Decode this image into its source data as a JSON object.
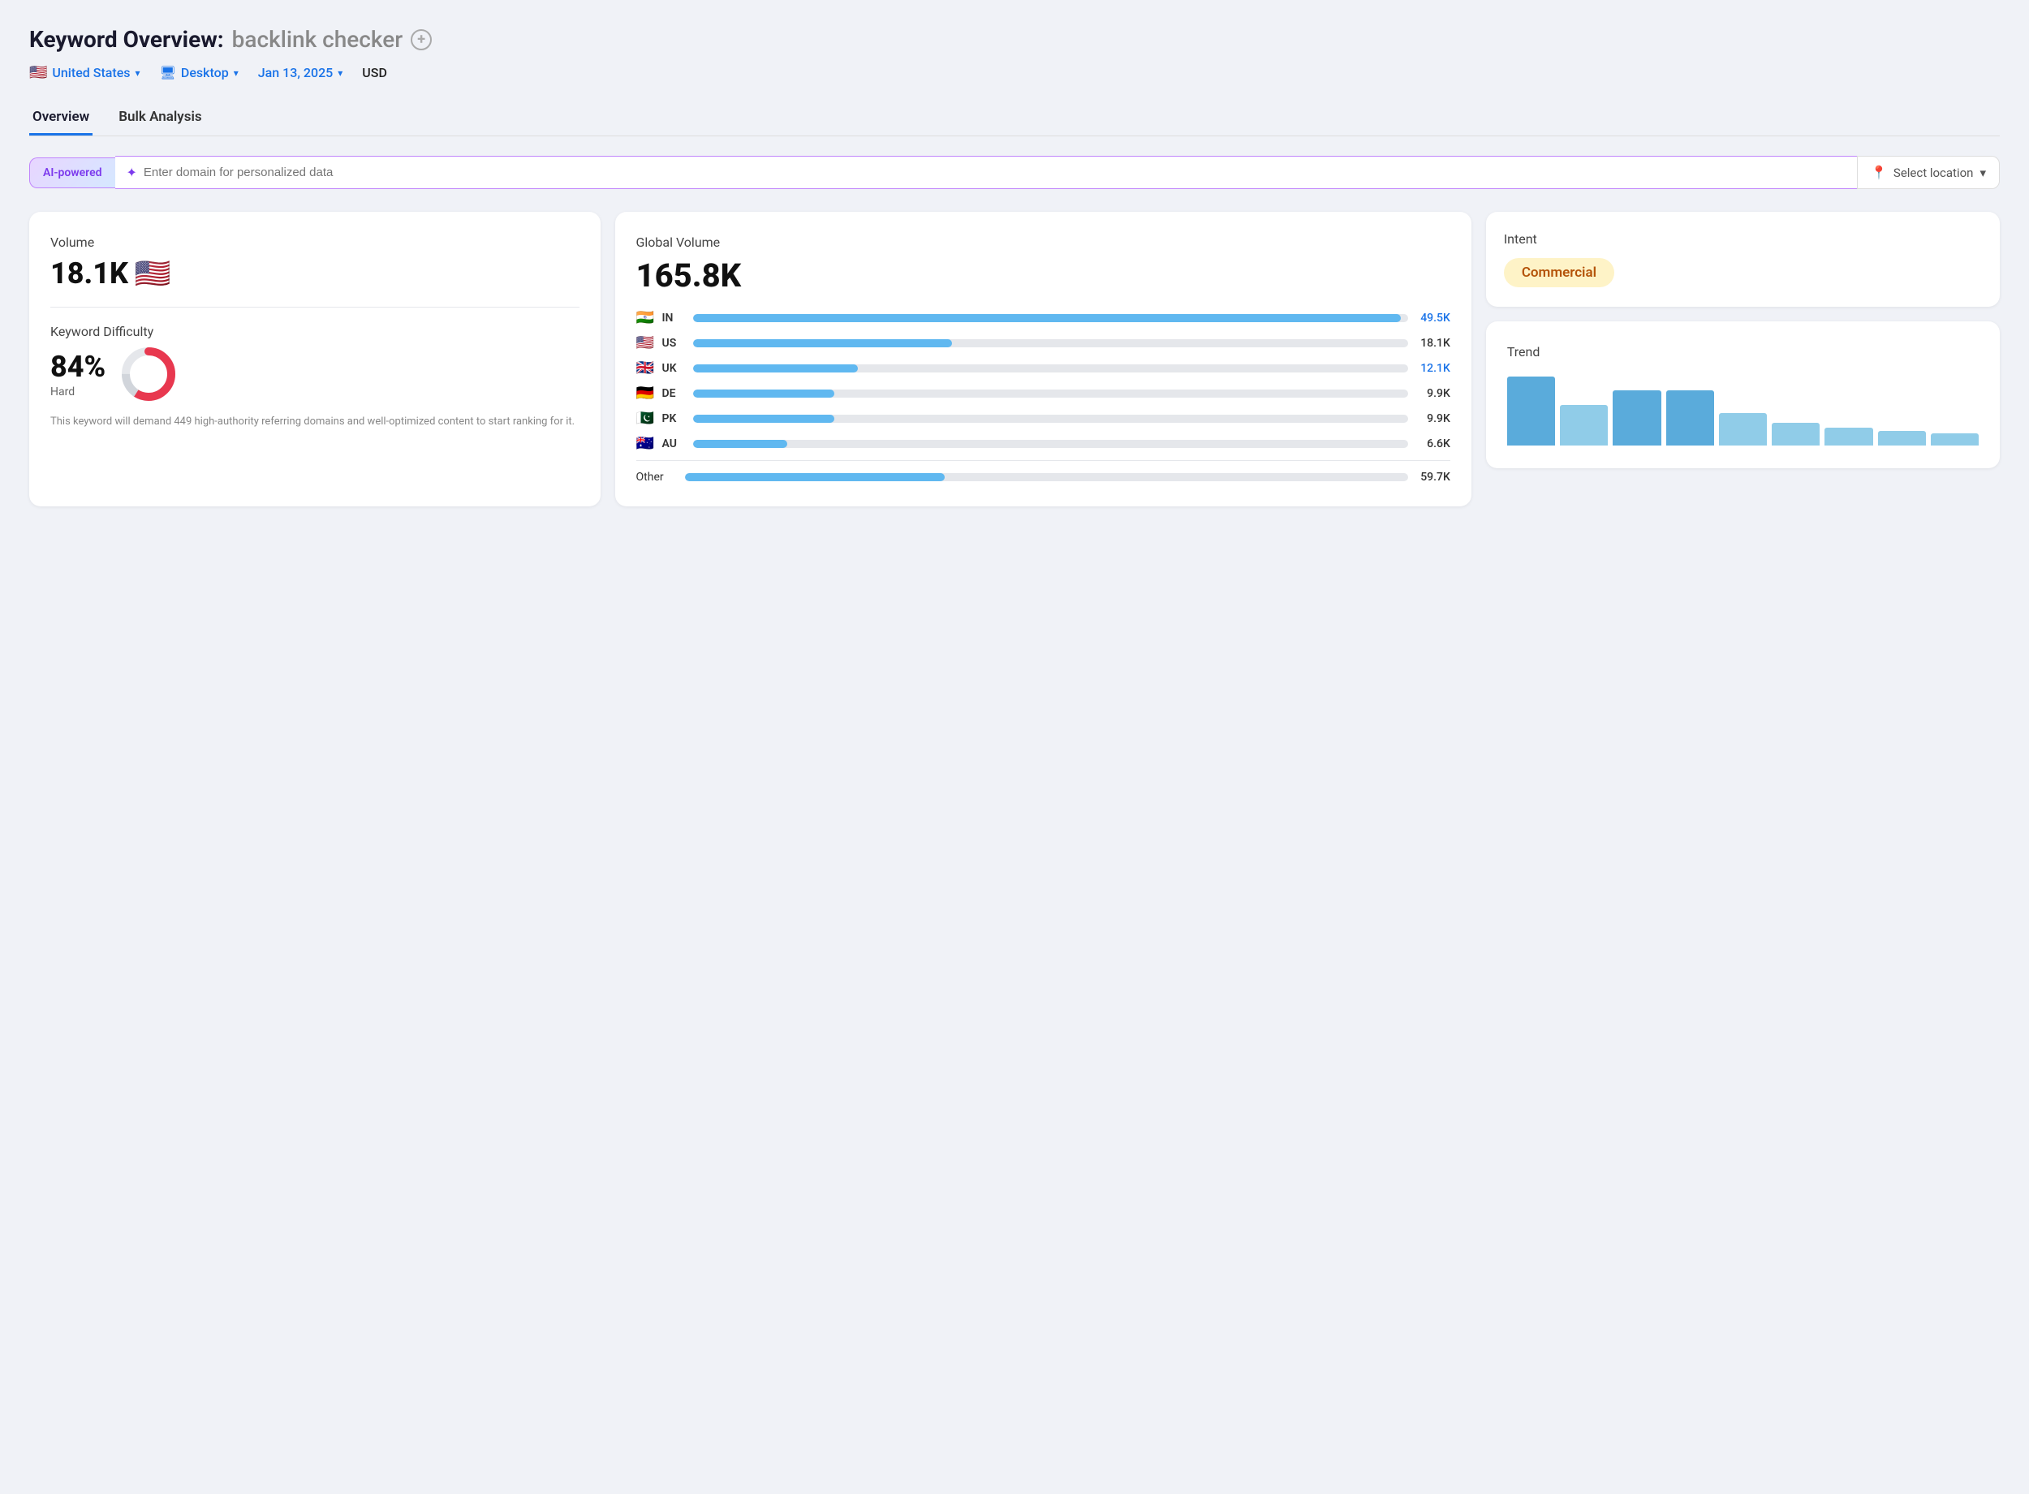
{
  "header": {
    "title_prefix": "Keyword Overview:",
    "title_keyword": "backlink checker",
    "add_icon_label": "+"
  },
  "filters": {
    "location": "United States",
    "location_flag": "🇺🇸",
    "device": "Desktop",
    "date": "Jan 13, 2025",
    "currency": "USD"
  },
  "tabs": [
    {
      "id": "overview",
      "label": "Overview",
      "active": true
    },
    {
      "id": "bulk",
      "label": "Bulk Analysis",
      "active": false
    }
  ],
  "ai_bar": {
    "badge_label": "AI-powered",
    "input_placeholder": "Enter domain for personalized data",
    "location_placeholder": "Select location",
    "chevron": "∨"
  },
  "volume_card": {
    "label": "Volume",
    "value": "18.1K",
    "flag": "🇺🇸"
  },
  "difficulty_card": {
    "label": "Keyword Difficulty",
    "value": "84%",
    "sublabel": "Hard",
    "description": "This keyword will demand 449 high-authority referring domains and well-optimized content to start ranking for it.",
    "donut_filled": 84,
    "donut_empty": 16
  },
  "global_volume": {
    "label": "Global Volume",
    "value": "165.8K",
    "countries": [
      {
        "flag": "🇮🇳",
        "code": "IN",
        "value": "49.5K",
        "bar_pct": 30,
        "colored": true
      },
      {
        "flag": "🇺🇸",
        "code": "US",
        "value": "18.1K",
        "bar_pct": 11,
        "colored": false
      },
      {
        "flag": "🇬🇧",
        "code": "UK",
        "value": "12.1K",
        "bar_pct": 7,
        "colored": true
      },
      {
        "flag": "🇩🇪",
        "code": "DE",
        "value": "9.9K",
        "bar_pct": 6,
        "colored": false
      },
      {
        "flag": "🇵🇰",
        "code": "PK",
        "value": "9.9K",
        "bar_pct": 6,
        "colored": false
      },
      {
        "flag": "🇦🇺",
        "code": "AU",
        "value": "6.6K",
        "bar_pct": 4,
        "colored": false
      }
    ],
    "other_label": "Other",
    "other_value": "59.7K",
    "other_bar_pct": 36
  },
  "intent": {
    "label": "Intent",
    "badge": "Commercial"
  },
  "trend": {
    "label": "Trend",
    "bars": [
      {
        "height": 85,
        "tall": true
      },
      {
        "height": 50,
        "tall": false
      },
      {
        "height": 68,
        "tall": true
      },
      {
        "height": 68,
        "tall": true
      },
      {
        "height": 40,
        "tall": false
      },
      {
        "height": 28,
        "tall": false
      },
      {
        "height": 22,
        "tall": false
      },
      {
        "height": 18,
        "tall": false
      },
      {
        "height": 15,
        "tall": false
      }
    ]
  }
}
